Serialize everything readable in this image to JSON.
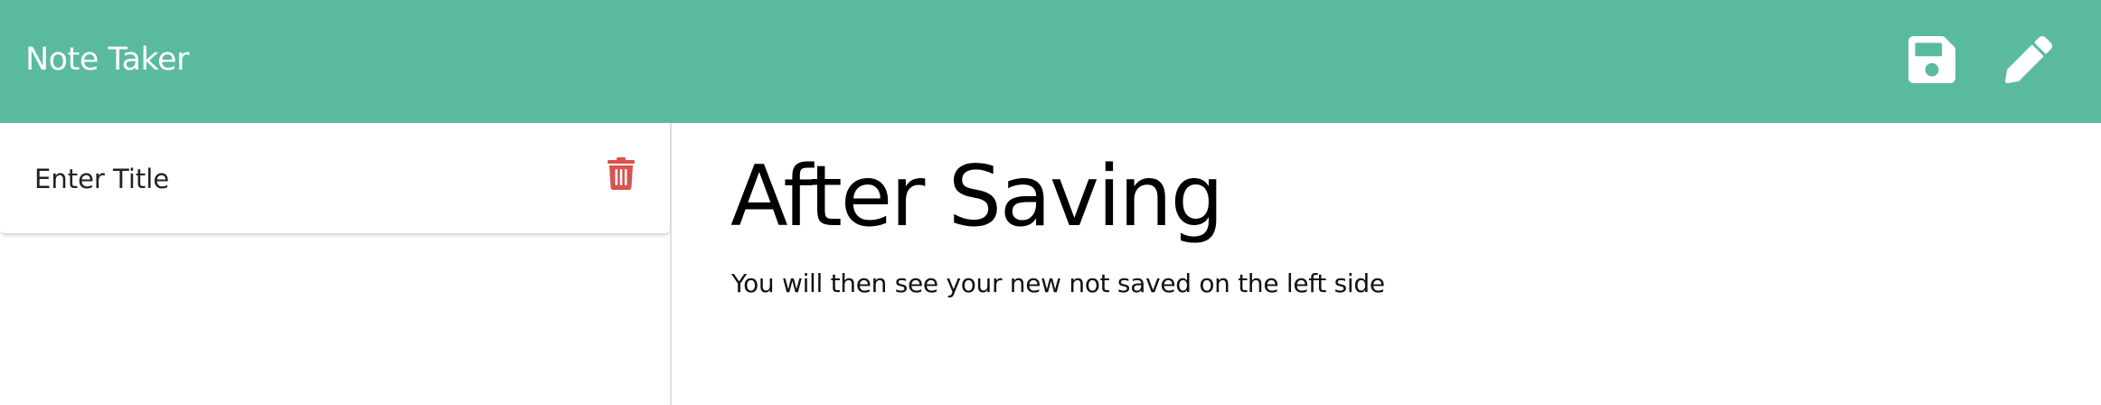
{
  "app": {
    "title": "Note Taker"
  },
  "toolbar": {
    "save_icon": "save-icon",
    "new_note_icon": "pencil-icon"
  },
  "sidebar": {
    "items": [
      {
        "title": "Enter Title",
        "action_icon": "trash-icon"
      }
    ]
  },
  "note": {
    "title": "After Saving",
    "text": "You will then see your new not saved on the left side"
  },
  "colors": {
    "navbar": "#5aba9f",
    "icon": "#ffffff",
    "delete": "#d9534f",
    "text": "#000000"
  }
}
